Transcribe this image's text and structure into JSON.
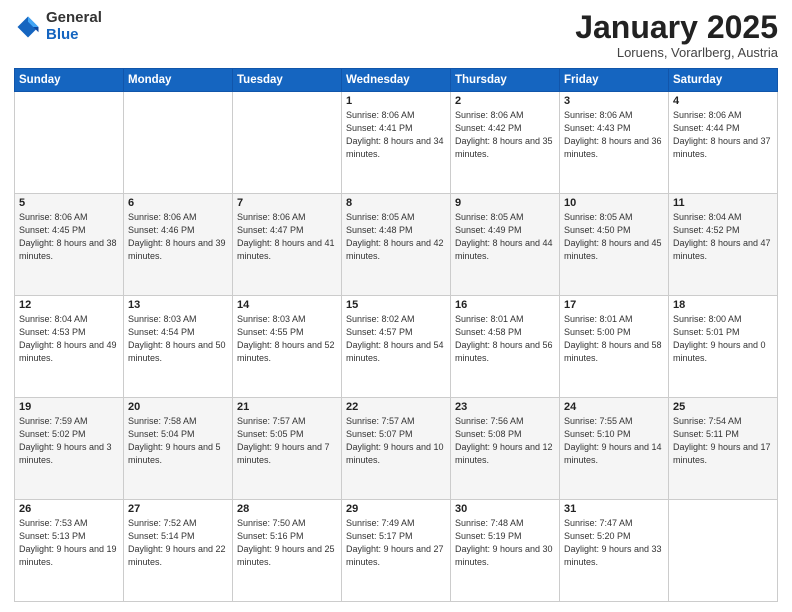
{
  "logo": {
    "general": "General",
    "blue": "Blue"
  },
  "title": "January 2025",
  "location": "Loruens, Vorarlberg, Austria",
  "days_header": [
    "Sunday",
    "Monday",
    "Tuesday",
    "Wednesday",
    "Thursday",
    "Friday",
    "Saturday"
  ],
  "weeks": [
    [
      {
        "day": "",
        "sunrise": "",
        "sunset": "",
        "daylight": ""
      },
      {
        "day": "",
        "sunrise": "",
        "sunset": "",
        "daylight": ""
      },
      {
        "day": "",
        "sunrise": "",
        "sunset": "",
        "daylight": ""
      },
      {
        "day": "1",
        "sunrise": "Sunrise: 8:06 AM",
        "sunset": "Sunset: 4:41 PM",
        "daylight": "Daylight: 8 hours and 34 minutes."
      },
      {
        "day": "2",
        "sunrise": "Sunrise: 8:06 AM",
        "sunset": "Sunset: 4:42 PM",
        "daylight": "Daylight: 8 hours and 35 minutes."
      },
      {
        "day": "3",
        "sunrise": "Sunrise: 8:06 AM",
        "sunset": "Sunset: 4:43 PM",
        "daylight": "Daylight: 8 hours and 36 minutes."
      },
      {
        "day": "4",
        "sunrise": "Sunrise: 8:06 AM",
        "sunset": "Sunset: 4:44 PM",
        "daylight": "Daylight: 8 hours and 37 minutes."
      }
    ],
    [
      {
        "day": "5",
        "sunrise": "Sunrise: 8:06 AM",
        "sunset": "Sunset: 4:45 PM",
        "daylight": "Daylight: 8 hours and 38 minutes."
      },
      {
        "day": "6",
        "sunrise": "Sunrise: 8:06 AM",
        "sunset": "Sunset: 4:46 PM",
        "daylight": "Daylight: 8 hours and 39 minutes."
      },
      {
        "day": "7",
        "sunrise": "Sunrise: 8:06 AM",
        "sunset": "Sunset: 4:47 PM",
        "daylight": "Daylight: 8 hours and 41 minutes."
      },
      {
        "day": "8",
        "sunrise": "Sunrise: 8:05 AM",
        "sunset": "Sunset: 4:48 PM",
        "daylight": "Daylight: 8 hours and 42 minutes."
      },
      {
        "day": "9",
        "sunrise": "Sunrise: 8:05 AM",
        "sunset": "Sunset: 4:49 PM",
        "daylight": "Daylight: 8 hours and 44 minutes."
      },
      {
        "day": "10",
        "sunrise": "Sunrise: 8:05 AM",
        "sunset": "Sunset: 4:50 PM",
        "daylight": "Daylight: 8 hours and 45 minutes."
      },
      {
        "day": "11",
        "sunrise": "Sunrise: 8:04 AM",
        "sunset": "Sunset: 4:52 PM",
        "daylight": "Daylight: 8 hours and 47 minutes."
      }
    ],
    [
      {
        "day": "12",
        "sunrise": "Sunrise: 8:04 AM",
        "sunset": "Sunset: 4:53 PM",
        "daylight": "Daylight: 8 hours and 49 minutes."
      },
      {
        "day": "13",
        "sunrise": "Sunrise: 8:03 AM",
        "sunset": "Sunset: 4:54 PM",
        "daylight": "Daylight: 8 hours and 50 minutes."
      },
      {
        "day": "14",
        "sunrise": "Sunrise: 8:03 AM",
        "sunset": "Sunset: 4:55 PM",
        "daylight": "Daylight: 8 hours and 52 minutes."
      },
      {
        "day": "15",
        "sunrise": "Sunrise: 8:02 AM",
        "sunset": "Sunset: 4:57 PM",
        "daylight": "Daylight: 8 hours and 54 minutes."
      },
      {
        "day": "16",
        "sunrise": "Sunrise: 8:01 AM",
        "sunset": "Sunset: 4:58 PM",
        "daylight": "Daylight: 8 hours and 56 minutes."
      },
      {
        "day": "17",
        "sunrise": "Sunrise: 8:01 AM",
        "sunset": "Sunset: 5:00 PM",
        "daylight": "Daylight: 8 hours and 58 minutes."
      },
      {
        "day": "18",
        "sunrise": "Sunrise: 8:00 AM",
        "sunset": "Sunset: 5:01 PM",
        "daylight": "Daylight: 9 hours and 0 minutes."
      }
    ],
    [
      {
        "day": "19",
        "sunrise": "Sunrise: 7:59 AM",
        "sunset": "Sunset: 5:02 PM",
        "daylight": "Daylight: 9 hours and 3 minutes."
      },
      {
        "day": "20",
        "sunrise": "Sunrise: 7:58 AM",
        "sunset": "Sunset: 5:04 PM",
        "daylight": "Daylight: 9 hours and 5 minutes."
      },
      {
        "day": "21",
        "sunrise": "Sunrise: 7:57 AM",
        "sunset": "Sunset: 5:05 PM",
        "daylight": "Daylight: 9 hours and 7 minutes."
      },
      {
        "day": "22",
        "sunrise": "Sunrise: 7:57 AM",
        "sunset": "Sunset: 5:07 PM",
        "daylight": "Daylight: 9 hours and 10 minutes."
      },
      {
        "day": "23",
        "sunrise": "Sunrise: 7:56 AM",
        "sunset": "Sunset: 5:08 PM",
        "daylight": "Daylight: 9 hours and 12 minutes."
      },
      {
        "day": "24",
        "sunrise": "Sunrise: 7:55 AM",
        "sunset": "Sunset: 5:10 PM",
        "daylight": "Daylight: 9 hours and 14 minutes."
      },
      {
        "day": "25",
        "sunrise": "Sunrise: 7:54 AM",
        "sunset": "Sunset: 5:11 PM",
        "daylight": "Daylight: 9 hours and 17 minutes."
      }
    ],
    [
      {
        "day": "26",
        "sunrise": "Sunrise: 7:53 AM",
        "sunset": "Sunset: 5:13 PM",
        "daylight": "Daylight: 9 hours and 19 minutes."
      },
      {
        "day": "27",
        "sunrise": "Sunrise: 7:52 AM",
        "sunset": "Sunset: 5:14 PM",
        "daylight": "Daylight: 9 hours and 22 minutes."
      },
      {
        "day": "28",
        "sunrise": "Sunrise: 7:50 AM",
        "sunset": "Sunset: 5:16 PM",
        "daylight": "Daylight: 9 hours and 25 minutes."
      },
      {
        "day": "29",
        "sunrise": "Sunrise: 7:49 AM",
        "sunset": "Sunset: 5:17 PM",
        "daylight": "Daylight: 9 hours and 27 minutes."
      },
      {
        "day": "30",
        "sunrise": "Sunrise: 7:48 AM",
        "sunset": "Sunset: 5:19 PM",
        "daylight": "Daylight: 9 hours and 30 minutes."
      },
      {
        "day": "31",
        "sunrise": "Sunrise: 7:47 AM",
        "sunset": "Sunset: 5:20 PM",
        "daylight": "Daylight: 9 hours and 33 minutes."
      },
      {
        "day": "",
        "sunrise": "",
        "sunset": "",
        "daylight": ""
      }
    ]
  ]
}
